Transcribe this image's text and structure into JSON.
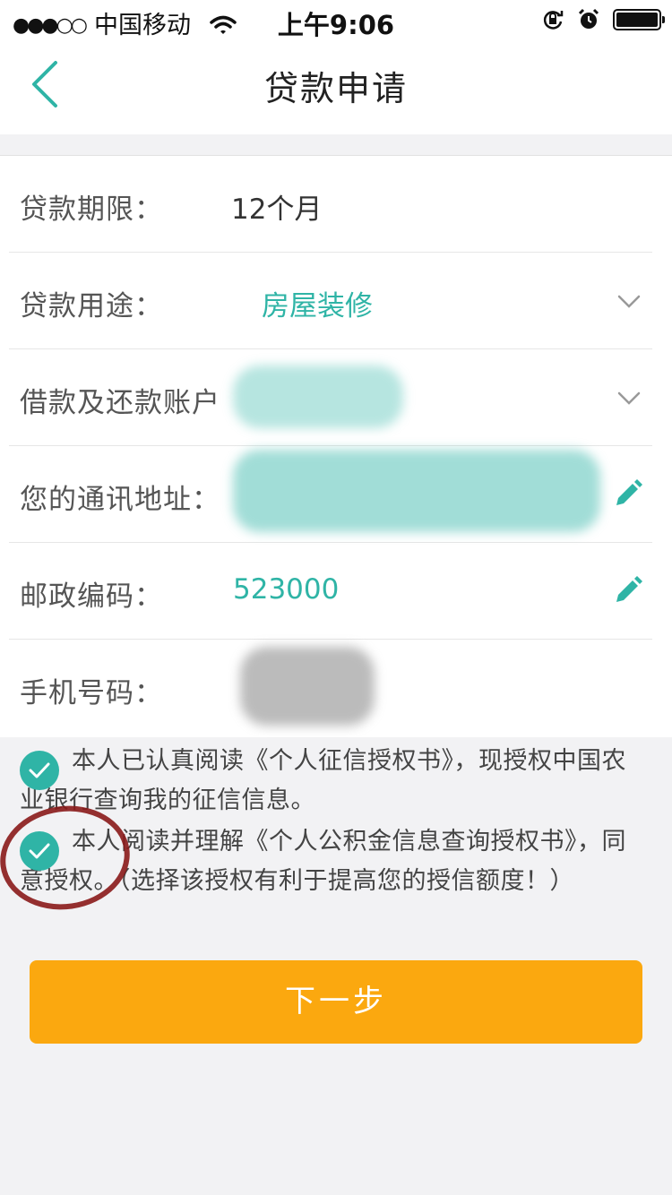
{
  "status_bar": {
    "signal_dots": "●●●○○",
    "carrier": "中国移动",
    "time": "上午9:06",
    "icons": [
      "wifi-icon",
      "rotation-lock-icon",
      "alarm-icon",
      "battery-icon"
    ]
  },
  "nav": {
    "back_icon": "chevron-left-icon",
    "title": "贷款申请"
  },
  "form": {
    "rows": [
      {
        "label": "贷款期限：",
        "value": "12个月"
      },
      {
        "label": "贷款用途：",
        "value": "房屋装修",
        "action_icon": "chevron-down-icon"
      },
      {
        "label": "借款及还款账户",
        "value": "",
        "action_icon": "chevron-down-icon"
      },
      {
        "label": "您的通讯地址：",
        "value": "",
        "action_icon": "pencil-icon"
      },
      {
        "label": "邮政编码：",
        "value": "523000",
        "action_icon": "pencil-icon"
      },
      {
        "label": "手机号码：",
        "value": ""
      }
    ]
  },
  "agreements": [
    {
      "checked": true,
      "text": "本人已认真阅读《个人征信授权书》，现授权中国农业银行查询我的征信信息。"
    },
    {
      "checked": true,
      "text": "本人阅读并理解《个人公积金信息查询授权书》，同意授权。（选择该授权有利于提高您的授信额度！）"
    }
  ],
  "next_button": {
    "label": "下一步"
  },
  "colors": {
    "accent_teal": "#2fb4a6",
    "button_orange": "#fba80f",
    "annotation_red": "#8a1a1a",
    "background": "#f2f2f4"
  }
}
